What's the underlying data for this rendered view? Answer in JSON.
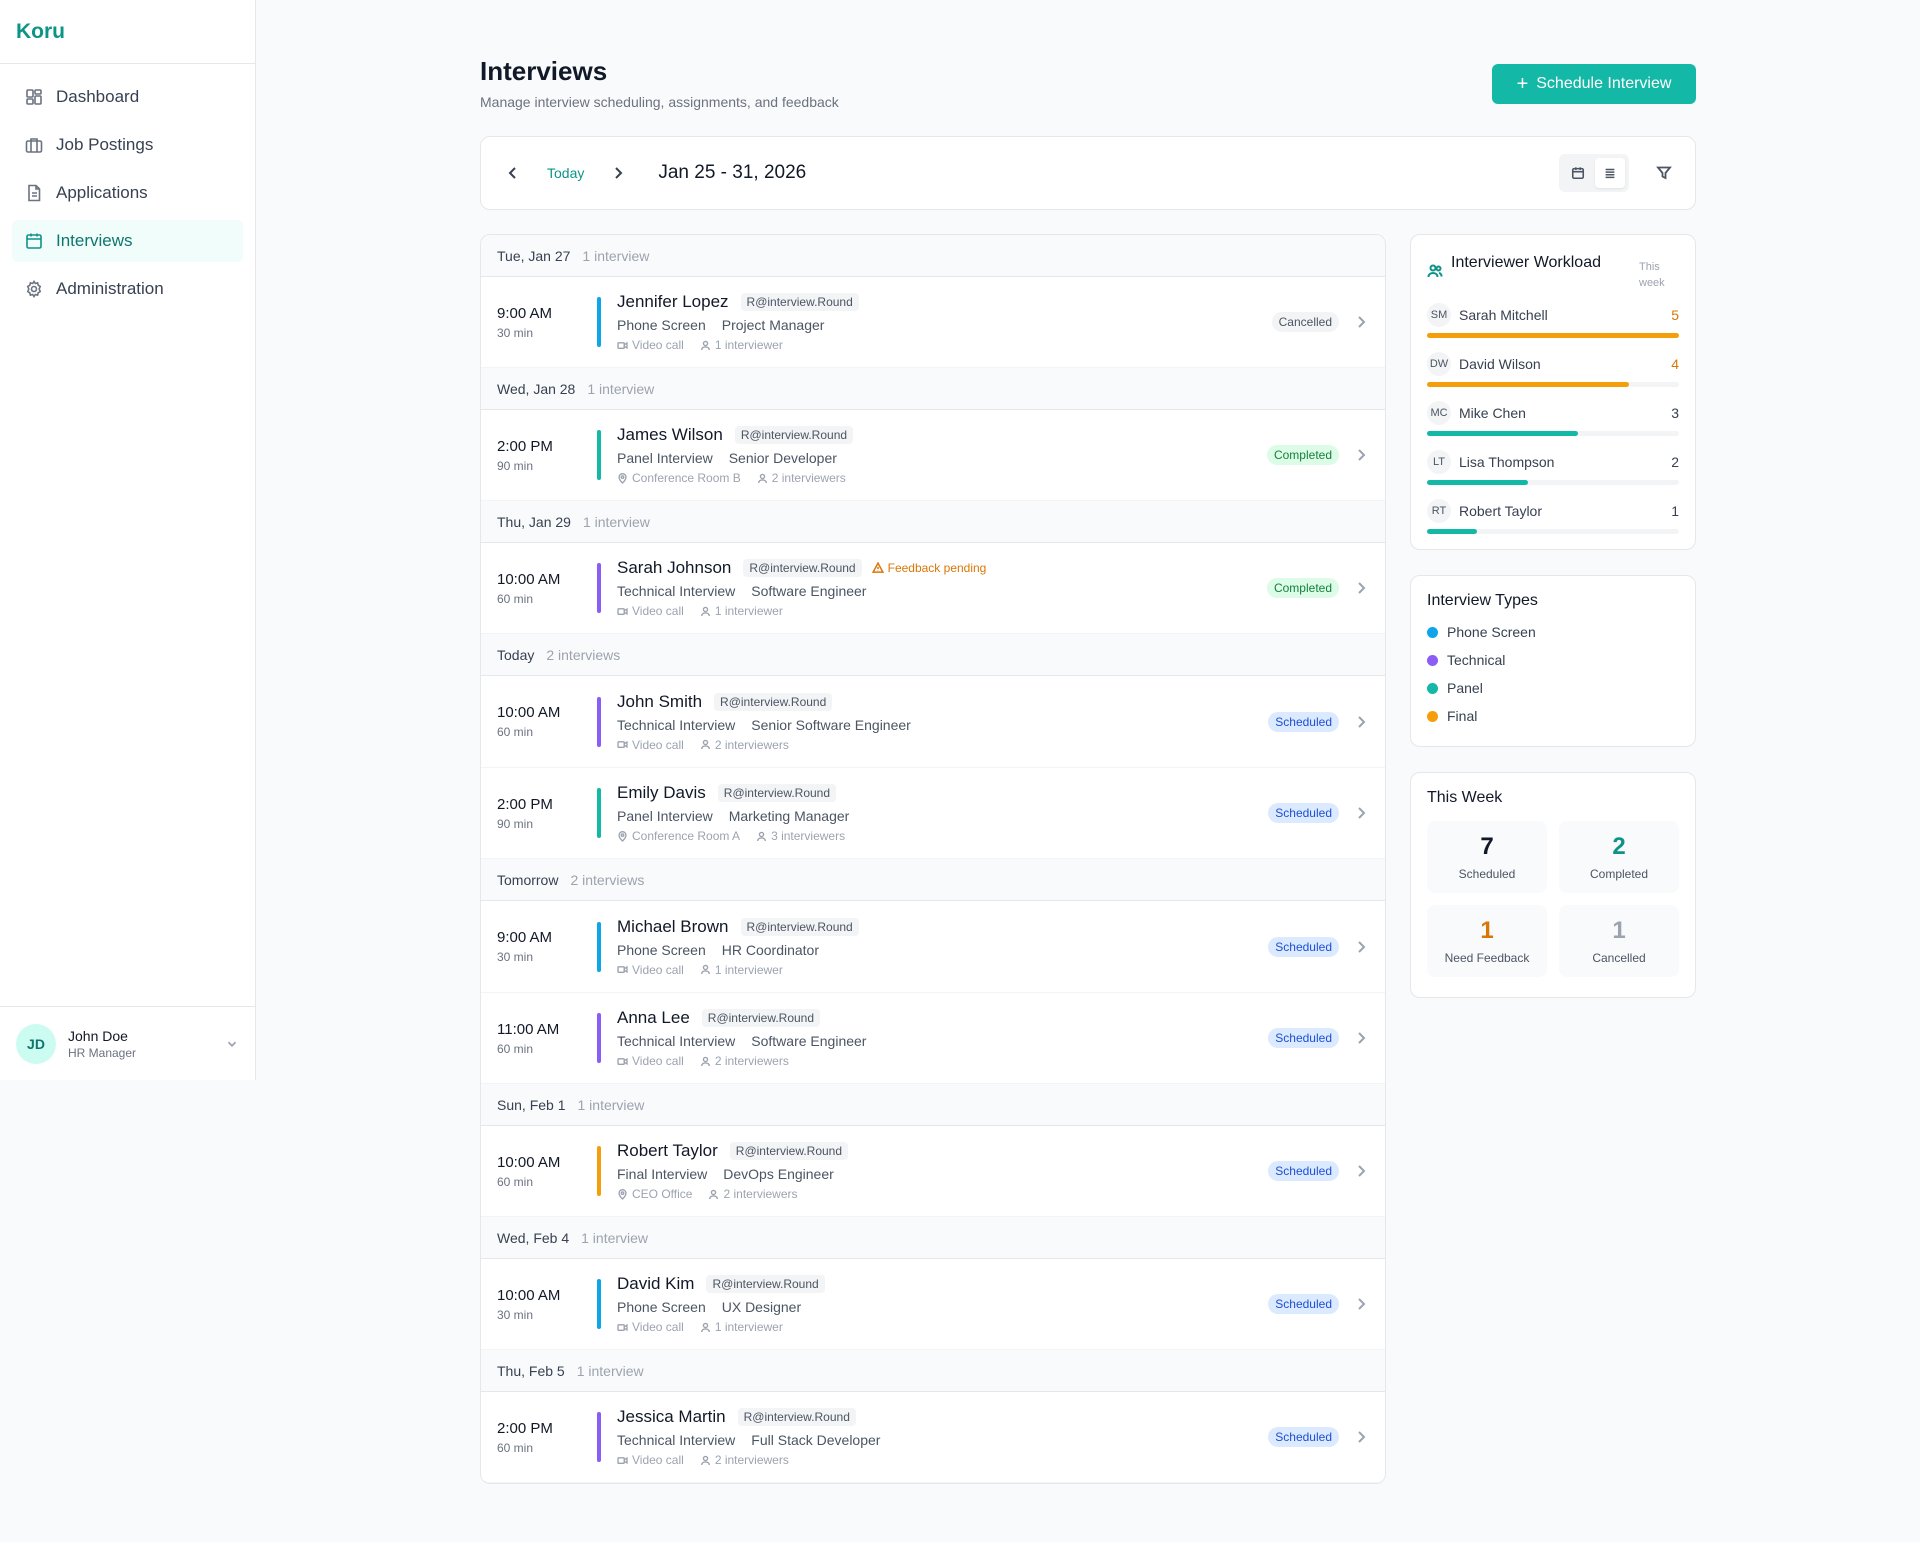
{
  "brand": "Koru",
  "nav": [
    {
      "label": "Dashboard",
      "icon": "dashboard-icon",
      "active": false
    },
    {
      "label": "Job Postings",
      "icon": "briefcase-icon",
      "active": false
    },
    {
      "label": "Applications",
      "icon": "document-icon",
      "active": false
    },
    {
      "label": "Interviews",
      "icon": "calendar-icon",
      "active": true
    },
    {
      "label": "Administration",
      "icon": "gear-icon",
      "active": false
    }
  ],
  "user": {
    "initials": "JD",
    "name": "John Doe",
    "role": "HR Manager"
  },
  "header": {
    "title": "Interviews",
    "subtitle": "Manage interview scheduling, assignments, and feedback",
    "schedule_button": "Schedule Interview"
  },
  "toolbar": {
    "today": "Today",
    "range": "Jan 25 - 31, 2026"
  },
  "groups": [
    {
      "label": "Tue, Jan 27",
      "count": "1 interview",
      "items": [
        {
          "time": "9:00 AM",
          "duration": "30 min",
          "candidate": "Jennifer Lopez",
          "round": "R@interview.Round",
          "type": "Phone Screen",
          "position": "Project Manager",
          "location": "Video call",
          "location_icon": "video-icon",
          "interviewers": "1 interviewer",
          "status": "Cancelled",
          "status_key": "cancelled",
          "color": "#0ea5e9"
        }
      ]
    },
    {
      "label": "Wed, Jan 28",
      "count": "1 interview",
      "items": [
        {
          "time": "2:00 PM",
          "duration": "90 min",
          "candidate": "James Wilson",
          "round": "R@interview.Round",
          "type": "Panel Interview",
          "position": "Senior Developer",
          "location": "Conference Room B",
          "location_icon": "location-icon",
          "interviewers": "2 interviewers",
          "status": "Completed",
          "status_key": "completed",
          "color": "#14b8a6"
        }
      ]
    },
    {
      "label": "Thu, Jan 29",
      "count": "1 interview",
      "items": [
        {
          "time": "10:00 AM",
          "duration": "60 min",
          "candidate": "Sarah Johnson",
          "round": "R@interview.Round",
          "feedback": "Feedback pending",
          "type": "Technical Interview",
          "position": "Software Engineer",
          "location": "Video call",
          "location_icon": "video-icon",
          "interviewers": "1 interviewer",
          "status": "Completed",
          "status_key": "completed",
          "color": "#8b5cf6"
        }
      ]
    },
    {
      "label": "Today",
      "count": "2 interviews",
      "items": [
        {
          "time": "10:00 AM",
          "duration": "60 min",
          "candidate": "John Smith",
          "round": "R@interview.Round",
          "type": "Technical Interview",
          "position": "Senior Software Engineer",
          "location": "Video call",
          "location_icon": "video-icon",
          "interviewers": "2 interviewers",
          "status": "Scheduled",
          "status_key": "scheduled",
          "color": "#8b5cf6"
        },
        {
          "time": "2:00 PM",
          "duration": "90 min",
          "candidate": "Emily Davis",
          "round": "R@interview.Round",
          "type": "Panel Interview",
          "position": "Marketing Manager",
          "location": "Conference Room A",
          "location_icon": "location-icon",
          "interviewers": "3 interviewers",
          "status": "Scheduled",
          "status_key": "scheduled",
          "color": "#14b8a6"
        }
      ]
    },
    {
      "label": "Tomorrow",
      "count": "2 interviews",
      "items": [
        {
          "time": "9:00 AM",
          "duration": "30 min",
          "candidate": "Michael Brown",
          "round": "R@interview.Round",
          "type": "Phone Screen",
          "position": "HR Coordinator",
          "location": "Video call",
          "location_icon": "video-icon",
          "interviewers": "1 interviewer",
          "status": "Scheduled",
          "status_key": "scheduled",
          "color": "#0ea5e9"
        },
        {
          "time": "11:00 AM",
          "duration": "60 min",
          "candidate": "Anna Lee",
          "round": "R@interview.Round",
          "type": "Technical Interview",
          "position": "Software Engineer",
          "location": "Video call",
          "location_icon": "video-icon",
          "interviewers": "2 interviewers",
          "status": "Scheduled",
          "status_key": "scheduled",
          "color": "#8b5cf6"
        }
      ]
    },
    {
      "label": "Sun, Feb 1",
      "count": "1 interview",
      "items": [
        {
          "time": "10:00 AM",
          "duration": "60 min",
          "candidate": "Robert Taylor",
          "round": "R@interview.Round",
          "type": "Final Interview",
          "position": "DevOps Engineer",
          "location": "CEO Office",
          "location_icon": "location-icon",
          "interviewers": "2 interviewers",
          "status": "Scheduled",
          "status_key": "scheduled",
          "color": "#f59e0b"
        }
      ]
    },
    {
      "label": "Wed, Feb 4",
      "count": "1 interview",
      "items": [
        {
          "time": "10:00 AM",
          "duration": "30 min",
          "candidate": "David Kim",
          "round": "R@interview.Round",
          "type": "Phone Screen",
          "position": "UX Designer",
          "location": "Video call",
          "location_icon": "video-icon",
          "interviewers": "1 interviewer",
          "status": "Scheduled",
          "status_key": "scheduled",
          "color": "#0ea5e9"
        }
      ]
    },
    {
      "label": "Thu, Feb 5",
      "count": "1 interview",
      "items": [
        {
          "time": "2:00 PM",
          "duration": "60 min",
          "candidate": "Jessica Martin",
          "round": "R@interview.Round",
          "type": "Technical Interview",
          "position": "Full Stack Developer",
          "location": "Video call",
          "location_icon": "video-icon",
          "interviewers": "2 interviewers",
          "status": "Scheduled",
          "status_key": "scheduled",
          "color": "#8b5cf6"
        }
      ]
    }
  ],
  "workload": {
    "title": "Interviewer Workload",
    "period": "This week",
    "max": 5,
    "people": [
      {
        "initials": "SM",
        "name": "Sarah Mitchell",
        "count": 5,
        "color": "#f59e0b"
      },
      {
        "initials": "DW",
        "name": "David Wilson",
        "count": 4,
        "color": "#f59e0b"
      },
      {
        "initials": "MC",
        "name": "Mike Chen",
        "count": 3,
        "color": "#14b8a6"
      },
      {
        "initials": "LT",
        "name": "Lisa Thompson",
        "count": 2,
        "color": "#14b8a6"
      },
      {
        "initials": "RT",
        "name": "Robert Taylor",
        "count": 1,
        "color": "#14b8a6"
      }
    ]
  },
  "types": {
    "title": "Interview Types",
    "items": [
      {
        "label": "Phone Screen",
        "color": "#0ea5e9"
      },
      {
        "label": "Technical",
        "color": "#8b5cf6"
      },
      {
        "label": "Panel",
        "color": "#14b8a6"
      },
      {
        "label": "Final",
        "color": "#f59e0b"
      }
    ]
  },
  "week": {
    "title": "This Week",
    "stats": [
      {
        "value": "7",
        "label": "Scheduled",
        "color": "#111827"
      },
      {
        "value": "2",
        "label": "Completed",
        "color": "#0d9488"
      },
      {
        "value": "1",
        "label": "Need Feedback",
        "color": "#d97706"
      },
      {
        "value": "1",
        "label": "Cancelled",
        "color": "#9ca3af"
      }
    ]
  }
}
